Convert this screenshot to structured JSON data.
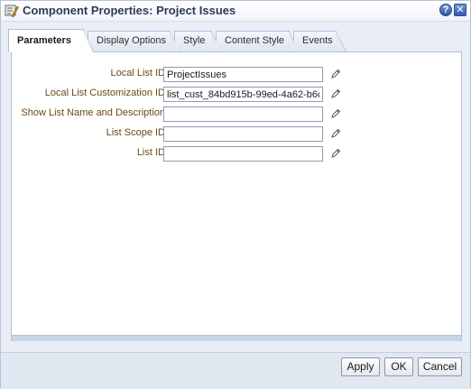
{
  "dialog": {
    "title": "Component Properties: Project Issues",
    "help_label": "?",
    "close_label": "✕"
  },
  "tabs": [
    {
      "label": "Parameters",
      "active": true
    },
    {
      "label": "Display Options",
      "active": false
    },
    {
      "label": "Style",
      "active": false
    },
    {
      "label": "Content Style",
      "active": false
    },
    {
      "label": "Events",
      "active": false
    }
  ],
  "fields": [
    {
      "label": "Local List ID",
      "value": "ProjectIssues"
    },
    {
      "label": "Local List Customization ID",
      "value": "list_cust_84bd915b-99ed-4a62-b6c"
    },
    {
      "label": "Show List Name and Description",
      "value": ""
    },
    {
      "label": "List Scope ID",
      "value": ""
    },
    {
      "label": "List ID",
      "value": ""
    }
  ],
  "buttons": {
    "apply": "Apply",
    "ok": "OK",
    "cancel": "Cancel"
  },
  "colors": {
    "label_text": "#6b4a16",
    "title_text": "#2b3b5a",
    "accent": "#2f5aa6"
  }
}
